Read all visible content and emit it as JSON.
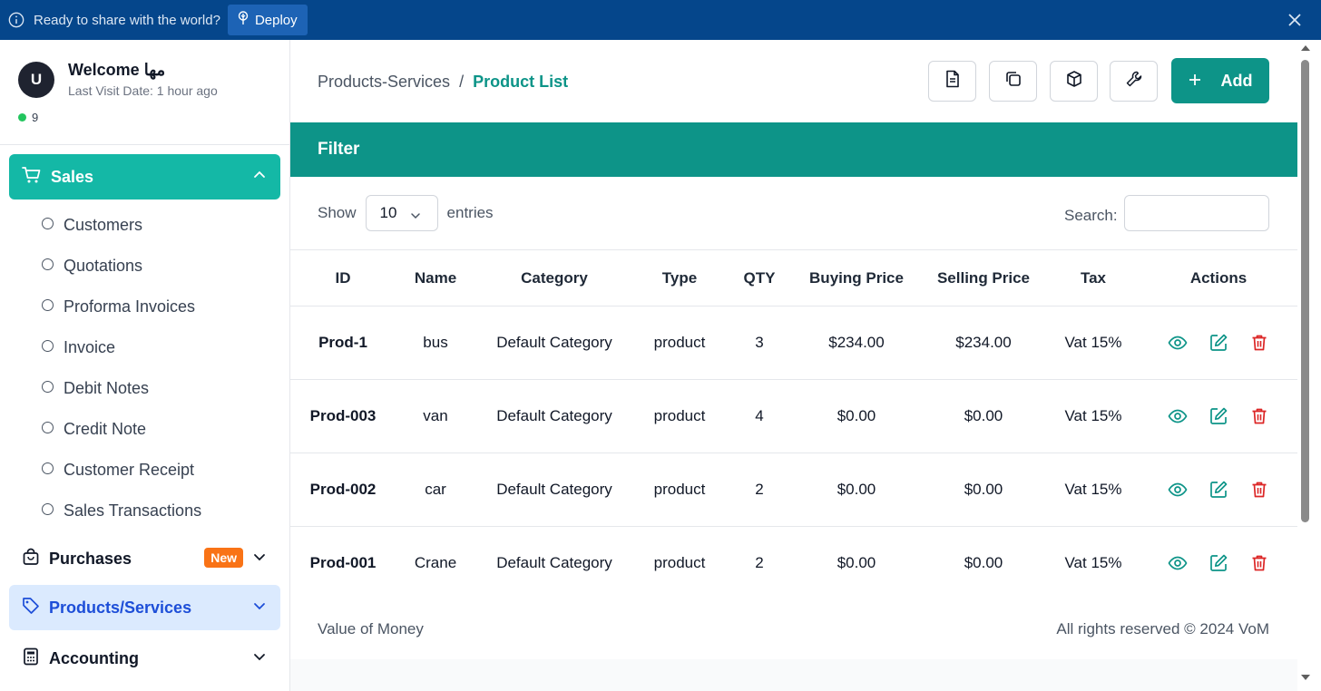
{
  "banner": {
    "message": "Ready to share with the world?",
    "deploy_label": "Deploy",
    "bg_color": "#05468b"
  },
  "user": {
    "avatar_letter": "U",
    "welcome": "Welcome مها",
    "last_visit": "Last Visit Date: 1 hour ago",
    "online_count": "9"
  },
  "sidebar": {
    "sales_label": "Sales",
    "sales_items": [
      "Customers",
      "Quotations",
      "Proforma Invoices",
      "Invoice",
      "Debit Notes",
      "Credit Note",
      "Customer Receipt",
      "Sales Transactions"
    ],
    "purchases_label": "Purchases",
    "purchases_badge": "New",
    "products_label": "Products/Services",
    "accounting_label": "Accounting"
  },
  "breadcrumb": {
    "parent": "Products-Services",
    "separator": "/",
    "current": "Product List"
  },
  "toolbar": {
    "icons": [
      "document-icon",
      "copy-icon",
      "box-icon",
      "wrench-icon"
    ],
    "add_label": "Add"
  },
  "filter": {
    "title": "Filter"
  },
  "table_controls": {
    "show_label": "Show",
    "page_size": "10",
    "entries_label": "entries",
    "search_label": "Search:"
  },
  "table": {
    "headers": [
      "ID",
      "Name",
      "Category",
      "Type",
      "QTY",
      "Buying Price",
      "Selling Price",
      "Tax",
      "Actions"
    ],
    "rows": [
      [
        "Prod-1",
        "bus",
        "Default Category",
        "product",
        "3",
        "$234.00",
        "$234.00",
        "Vat 15%"
      ],
      [
        "Prod-003",
        "van",
        "Default Category",
        "product",
        "4",
        "$0.00",
        "$0.00",
        "Vat 15%"
      ],
      [
        "Prod-002",
        "car",
        "Default Category",
        "product",
        "2",
        "$0.00",
        "$0.00",
        "Vat 15%"
      ],
      [
        "Prod-001",
        "Crane",
        "Default Category",
        "product",
        "2",
        "$0.00",
        "$0.00",
        "Vat 15%"
      ]
    ]
  },
  "footer": {
    "left": "Value of Money",
    "right": "All rights reserved © 2024 VoM"
  },
  "colors": {
    "accent": "#0d9488",
    "sales_active": "#14b8a6",
    "delete": "#dc2626",
    "badge": "#f97316"
  }
}
